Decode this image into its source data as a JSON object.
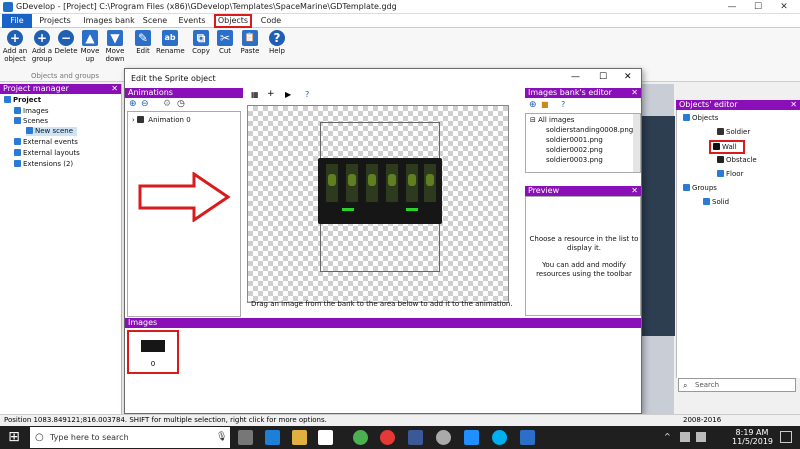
{
  "window": {
    "title": "GDevelop - [Project] C:\\Program Files (x86)\\GDevelop\\Templates\\SpaceMarine\\GDTemplate.gdg"
  },
  "menu": {
    "tabs": [
      "File",
      "Projects",
      "Images bank",
      "Scene",
      "Events",
      "Objects",
      "Code"
    ]
  },
  "ribbon": {
    "buttons": [
      {
        "label": "Add an object",
        "glyph": "+"
      },
      {
        "label": "Add a group",
        "glyph": "+"
      },
      {
        "label": "Delete",
        "glyph": "−"
      },
      {
        "label": "Move up",
        "glyph": "▲"
      },
      {
        "label": "Move down",
        "glyph": "▼"
      },
      {
        "label": "Edit",
        "glyph": "✎"
      },
      {
        "label": "Rename",
        "glyph": "ab"
      },
      {
        "label": "Copy",
        "glyph": "⧉"
      },
      {
        "label": "Cut",
        "glyph": "✂"
      },
      {
        "label": "Paste",
        "glyph": "📋"
      },
      {
        "label": "Help",
        "glyph": "?"
      }
    ],
    "group_label": "Objects and groups"
  },
  "project_manager": {
    "header": "Project manager",
    "items": [
      "Project",
      "Images",
      "Scenes",
      "New scene",
      "External events",
      "External layouts",
      "Extensions (2)"
    ]
  },
  "dialog": {
    "title": "Edit the Sprite object",
    "animations_header": "Animations",
    "animation_item": "Animation 0",
    "hint": "Drag an image from the bank to the area below to add it to the animation.",
    "images_bank_header": "Images bank's editor",
    "images_bank_items": [
      "All images",
      "soldierstanding0008.png",
      "soldier0001.png",
      "soldier0002.png",
      "soldier0003.png"
    ],
    "preview_header": "Preview",
    "preview_text_1": "Choose a resource in the list to display it.",
    "preview_text_2": "You can add and modify resources using the toolbar",
    "images_header": "Images",
    "image_index": "0"
  },
  "objects_editor": {
    "header": "Objects' editor",
    "items": [
      "Objects",
      "Soldier",
      "Wall",
      "Obstacle",
      "Floor",
      "Groups",
      "Solid"
    ],
    "search_placeholder": "Search"
  },
  "status": {
    "text": "Position 1083.849121;816.003784. SHIFT for multiple selection, right click for more options.",
    "right": "2008-2016"
  },
  "taskbar": {
    "search_placeholder": "Type here to search",
    "time": "8:19 AM",
    "date": "11/5/2019"
  },
  "colors": {
    "panel_header": "#8a0fb8",
    "accent": "#1a63c6",
    "highlight_box": "#d81b1b"
  }
}
